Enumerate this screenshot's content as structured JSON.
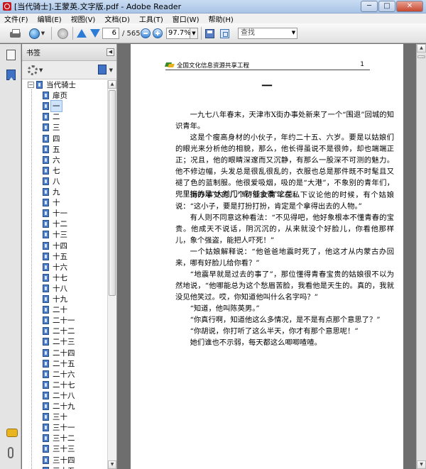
{
  "window": {
    "title": "[当代骑士].王蒙英.文字版.pdf - Adobe Reader",
    "minimize": "─",
    "maximize": "□",
    "close": "✕"
  },
  "menu": [
    "文件(F)",
    "编辑(E)",
    "视图(V)",
    "文档(D)",
    "工具(T)",
    "窗口(W)",
    "帮助(H)"
  ],
  "toolbar": {
    "page_current": "6",
    "page_total": "/ 565",
    "zoom": "97.7%",
    "search_placeholder": "查找"
  },
  "bookmarks": {
    "header": "书签",
    "items": [
      {
        "label": "当代骑士",
        "level": 0
      },
      {
        "label": "扉页",
        "level": 1
      },
      {
        "label": "一",
        "level": 1,
        "selected": true
      },
      {
        "label": "二",
        "level": 1
      },
      {
        "label": "三",
        "level": 1
      },
      {
        "label": "四",
        "level": 1
      },
      {
        "label": "五",
        "level": 1
      },
      {
        "label": "六",
        "level": 1
      },
      {
        "label": "七",
        "level": 1
      },
      {
        "label": "八",
        "level": 1
      },
      {
        "label": "九",
        "level": 1
      },
      {
        "label": "十",
        "level": 1
      },
      {
        "label": "十一",
        "level": 1
      },
      {
        "label": "十二",
        "level": 1
      },
      {
        "label": "十三",
        "level": 1
      },
      {
        "label": "十四",
        "level": 1
      },
      {
        "label": "十五",
        "level": 1
      },
      {
        "label": "十六",
        "level": 1
      },
      {
        "label": "十七",
        "level": 1
      },
      {
        "label": "十八",
        "level": 1
      },
      {
        "label": "十九",
        "level": 1
      },
      {
        "label": "二十",
        "level": 1
      },
      {
        "label": "二十一",
        "level": 1
      },
      {
        "label": "二十二",
        "level": 1
      },
      {
        "label": "二十三",
        "level": 1
      },
      {
        "label": "二十四",
        "level": 1
      },
      {
        "label": "二十五",
        "level": 1
      },
      {
        "label": "二十六",
        "level": 1
      },
      {
        "label": "二十七",
        "level": 1
      },
      {
        "label": "二十八",
        "level": 1
      },
      {
        "label": "二十九",
        "level": 1
      },
      {
        "label": "三十",
        "level": 1
      },
      {
        "label": "三十一",
        "level": 1
      },
      {
        "label": "三十二",
        "level": 1
      },
      {
        "label": "三十三",
        "level": 1
      },
      {
        "label": "三十四",
        "level": 1
      },
      {
        "label": "三十五",
        "level": 1
      }
    ]
  },
  "document": {
    "header_text": "全国文化信息资源共享工程",
    "header_page": "1",
    "chapter_title": "一",
    "paragraphs": [
      "一九七八年春末，天津市X街办事处新来了一个“围退”回城的知识青年。",
      "这是个瘦高身材的小伙子，年约二十五、六岁。要是以姑娘们的眼光来分析他的相貌，那么，他长得虽说不是很帅，却也端端正正；况且，他的眼睛深邃而又沉静，有那么一股深不可测的魅力。他不修边幅，头发总是很乱很乱的，衣服也总是那件既不时髦且又褪了色的蓝制服。他很爱吸烟，吸的是“大港”，不象别的青年们，兜里揣的是“大前门”或“郁金香”之类。",
      "街办事处的几个待业女青年在私下议论他的时候，有个姑娘说：“这小子，要是打扮打扮，肯定是个拿得出去的人物。”",
      "有人则不同意这种看法：“不见得吧，他好象根本不懂青春的宝贵。他成天不说话，阴沉沉的，从来就没个好脸儿，你看他那样儿，象个强盗，能把人吓死！”",
      "一个姑娘解释说：“他爸爸地震时死了，他这才从内蒙古办回来，哪有好脸儿给你看？”",
      "“地震早就是过去的事了”，那位懂得青春宝贵的姑娘很不以为然地说，“他哪能总为这个愁眉苦脸，我看他是天生的。真的，我就没见他笑过。哎，你知道他叫什么名字吗？”",
      "“知道，他叫陈英男。”",
      "“你真行啊，知道他这么多情况，是不是有点那个意思了？”",
      "“你胡说，你打听了这么半天，你才有那个意思呢！”",
      "她们谁也不示弱，每天都这么唧唧喳喳。"
    ]
  }
}
